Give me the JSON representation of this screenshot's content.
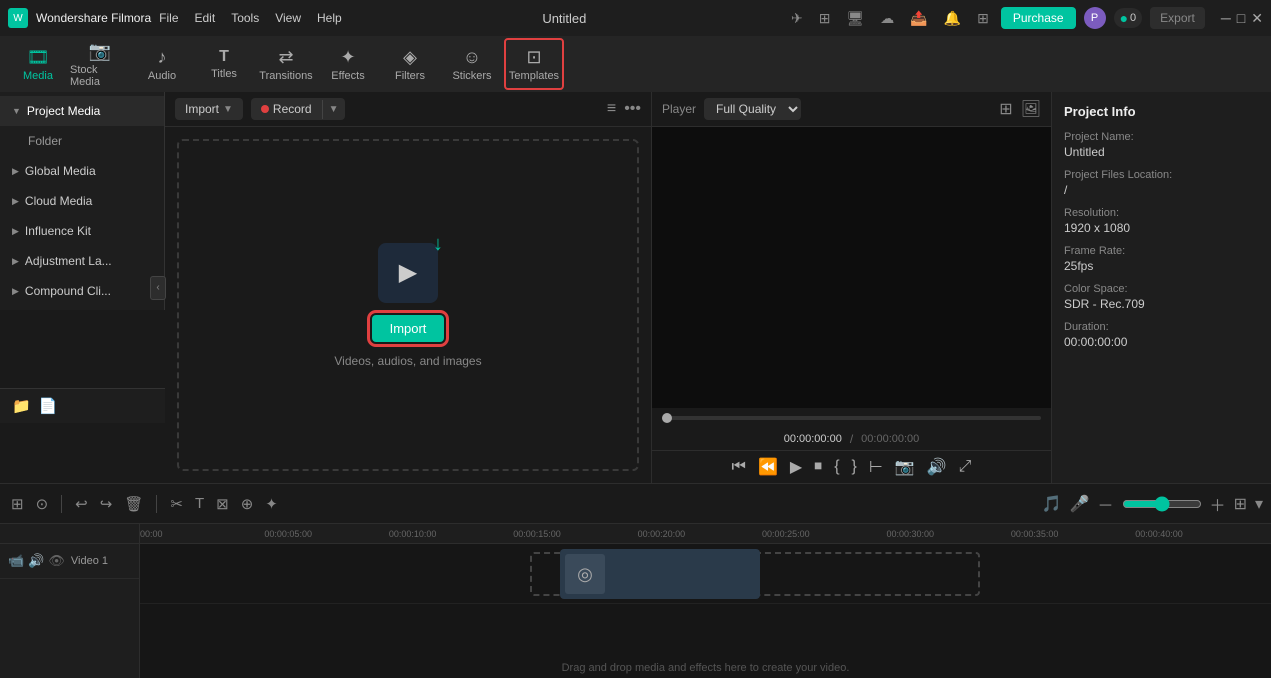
{
  "app": {
    "name": "Wondershare Filmora",
    "title": "Untitled"
  },
  "titlebar": {
    "menu_items": [
      "File",
      "Edit",
      "Tools",
      "View",
      "Help"
    ],
    "purchase_label": "Purchase",
    "profile_letter": "P",
    "points": "0",
    "export_label": "Export"
  },
  "toolbar": {
    "items": [
      {
        "id": "media",
        "label": "Media",
        "icon": "🎞",
        "active": true
      },
      {
        "id": "stock-media",
        "label": "Stock Media",
        "icon": "📷"
      },
      {
        "id": "audio",
        "label": "Audio",
        "icon": "🎵"
      },
      {
        "id": "titles",
        "label": "Titles",
        "icon": "T"
      },
      {
        "id": "transitions",
        "label": "Transitions",
        "icon": "⇄"
      },
      {
        "id": "effects",
        "label": "Effects",
        "icon": "✨"
      },
      {
        "id": "filters",
        "label": "Filters",
        "icon": "🎨"
      },
      {
        "id": "stickers",
        "label": "Stickers",
        "icon": "😊"
      },
      {
        "id": "templates",
        "label": "Templates",
        "icon": "⊞",
        "selected_box": true
      }
    ]
  },
  "sidebar": {
    "items": [
      {
        "id": "project-media",
        "label": "Project Media",
        "active": true
      },
      {
        "id": "folder",
        "label": "Folder",
        "indent": true
      },
      {
        "id": "global-media",
        "label": "Global Media"
      },
      {
        "id": "cloud-media",
        "label": "Cloud Media"
      },
      {
        "id": "influence-kit",
        "label": "Influence Kit"
      },
      {
        "id": "adjustment-la",
        "label": "Adjustment La..."
      },
      {
        "id": "compound-cli",
        "label": "Compound Cli..."
      }
    ]
  },
  "media_area": {
    "import_label": "Import",
    "record_label": "Record",
    "import_subtitle": "Videos, audios, and images",
    "import_btn_label": "Import"
  },
  "player": {
    "player_label": "Player",
    "quality_label": "Full Quality",
    "time_current": "00:00:00:00",
    "time_separator": "/",
    "time_total": "00:00:00:00"
  },
  "project_info": {
    "title": "Project Info",
    "name_label": "Project Name:",
    "name_value": "Untitled",
    "files_label": "Project Files Location:",
    "files_value": "/",
    "resolution_label": "Resolution:",
    "resolution_value": "1920 x 1080",
    "framerate_label": "Frame Rate:",
    "framerate_value": "25fps",
    "colorspace_label": "Color Space:",
    "colorspace_value": "SDR - Rec.709",
    "duration_label": "Duration:",
    "duration_value": "00:00:00:00"
  },
  "timeline": {
    "ruler_marks": [
      "00:00:05:00",
      "00:00:10:00",
      "00:00:15:00",
      "00:00:20:00",
      "00:00:25:00",
      "00:00:30:00",
      "00:00:35:00",
      "00:00:40:00"
    ],
    "track_label": "Video 1",
    "drag_hint": "Drag and drop media and effects here to create your video.",
    "timeline_start": "00:00"
  },
  "colors": {
    "accent": "#00c4a0",
    "danger": "#e04040",
    "bg_dark": "#1a1a1a",
    "bg_medium": "#1e1e1e",
    "bg_light": "#252525",
    "border": "#2d2d2d"
  }
}
